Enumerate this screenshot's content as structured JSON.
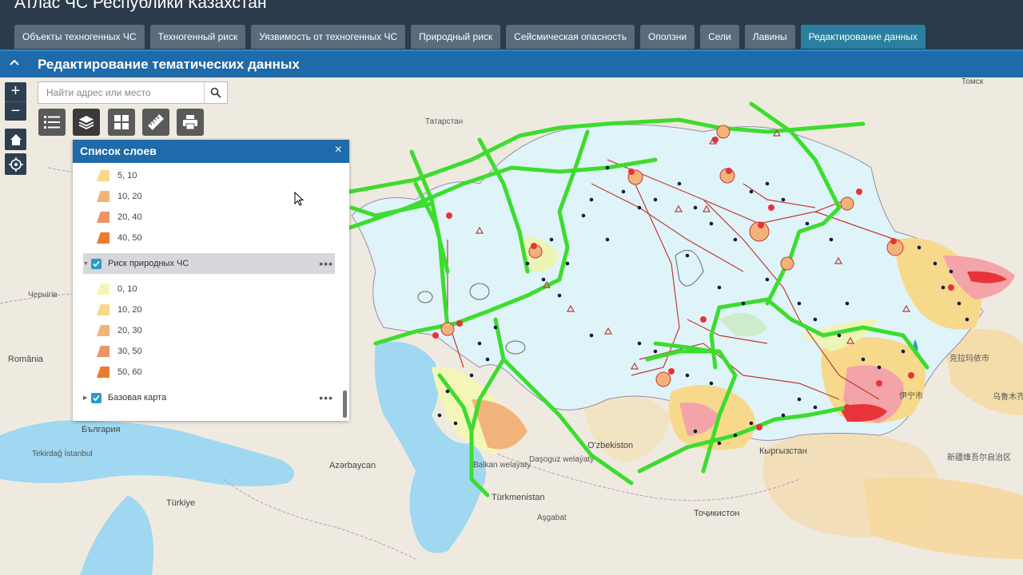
{
  "app": {
    "title": "Атлас ЧС Республики Казахстан"
  },
  "tabs": [
    {
      "label": "Объекты техногенных ЧС",
      "active": false
    },
    {
      "label": "Техногенный риск",
      "active": false
    },
    {
      "label": "Уязвимость от техногенных ЧС",
      "active": false
    },
    {
      "label": "Природный риск",
      "active": false
    },
    {
      "label": "Сейсмическая опасность",
      "active": false
    },
    {
      "label": "Оползни",
      "active": false
    },
    {
      "label": "Сели",
      "active": false
    },
    {
      "label": "Лавины",
      "active": false
    },
    {
      "label": "Редактирование данных",
      "active": true
    }
  ],
  "panel": {
    "title": "Редактирование тематических данных"
  },
  "map_controls": {
    "zoom_in": "+",
    "zoom_out": "−"
  },
  "search": {
    "placeholder": "Найти адрес или место"
  },
  "toolbar": {
    "icons": [
      "legend-icon",
      "layers-icon",
      "basemap-gallery-icon",
      "measure-icon",
      "print-icon"
    ]
  },
  "layer_list": {
    "title": "Список слоев",
    "close": "×",
    "legend_top": [
      {
        "label": "5, 10",
        "color": "#f7d98b"
      },
      {
        "label": "10, 20",
        "color": "#f2b37a"
      },
      {
        "label": "20, 40",
        "color": "#ee946a"
      },
      {
        "label": "40, 50",
        "color": "#ec7a2e"
      }
    ],
    "group_natural": {
      "label": "Риск природных ЧС",
      "checked": true,
      "menu": "•••"
    },
    "legend_natural": [
      {
        "label": "0, 10",
        "color": "#f4f6b8"
      },
      {
        "label": "10, 20",
        "color": "#f7d98b"
      },
      {
        "label": "20, 30",
        "color": "#f2b37a"
      },
      {
        "label": "30, 50",
        "color": "#ee946a"
      },
      {
        "label": "50, 60",
        "color": "#ec7a2e"
      }
    ],
    "group_base": {
      "label": "Базовая карта",
      "checked": true,
      "menu": "•••"
    }
  },
  "map_labels": {
    "tomsk": "Томск",
    "tatarstan": "Татарстан",
    "chernihiv": "Чернігів",
    "romania": "România",
    "bulgaria": "България",
    "tekirdag": "Tekirdağ İstanbul",
    "turkiye": "Türkiye",
    "azerbaijan": "Azərbaycan",
    "turkmenistan": "Türkmenistan",
    "ashgabat": "Aşgabat",
    "tajikistan": "Тоҷикистон",
    "uzbekistan": "O'zbekiston",
    "kyrgyzstan": "Кыргызстан",
    "karamay": "克拉玛依市",
    "urumqi": "乌鲁木齐",
    "yining": "伊宁市",
    "xinjiang": "新疆维吾尔自治区",
    "balkan": "Balkan welaýaty",
    "dasoguz": "Daşoguz welaýaty"
  },
  "colors": {
    "kazakhstan_fill": "#dff4f9",
    "pipeline": "#3ddc2e",
    "risk_red": "#e8333b",
    "point_dark": "#121a3a",
    "sea": "#9fd8f0"
  }
}
